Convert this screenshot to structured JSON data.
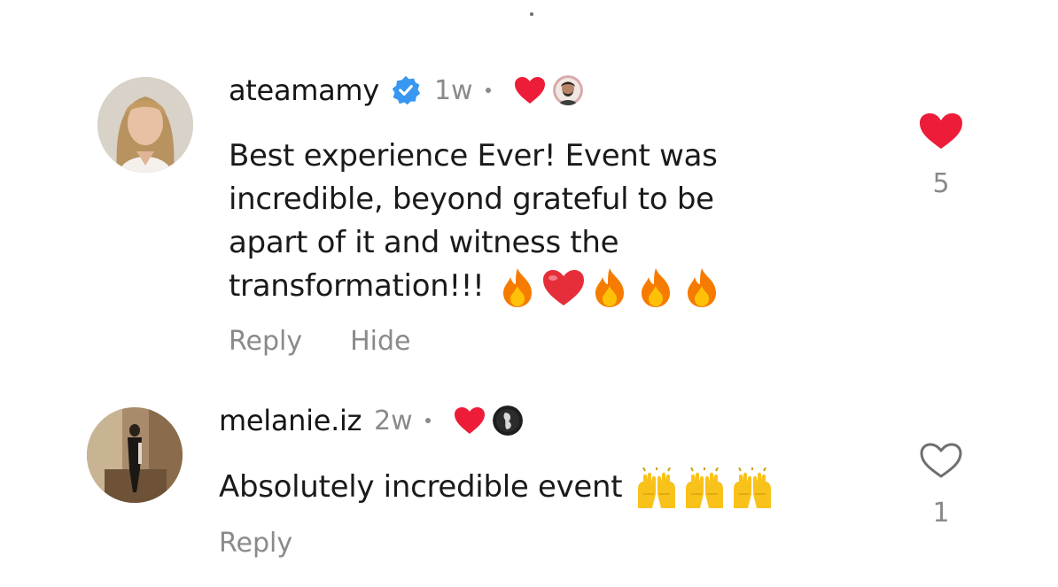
{
  "comments": [
    {
      "username": "ateamamy",
      "verified": true,
      "time": "1w",
      "liked_by_creator": true,
      "text": "Best experience Ever!  Event was incredible, beyond grateful to be apart of it and witness the transformation!!!",
      "text_lines": [
        "Best experience Ever!  Event was",
        "incredible, beyond grateful to be",
        "apart of it and witness the",
        "transformation!!!"
      ],
      "emojis": [
        "fire-icon",
        "red-heart-icon",
        "fire-icon",
        "fire-icon",
        "fire-icon"
      ],
      "actions": [
        "Reply",
        "Hide"
      ],
      "like_count": "5",
      "liked": true
    },
    {
      "username": "melanie.iz",
      "verified": false,
      "time": "2w",
      "liked_by_creator": true,
      "text": "Absolutely incredible event",
      "emojis": [
        "raised-hands-icon",
        "raised-hands-icon",
        "raised-hands-icon"
      ],
      "actions": [
        "Reply"
      ],
      "like_count": "1",
      "liked": false
    }
  ],
  "colors": {
    "heart_red": "#ed1d3a",
    "verified_blue": "#3897f0",
    "muted_text": "#8a8a8a",
    "fire_orange": "#f57c00",
    "hands_yellow": "#f9c21b"
  }
}
